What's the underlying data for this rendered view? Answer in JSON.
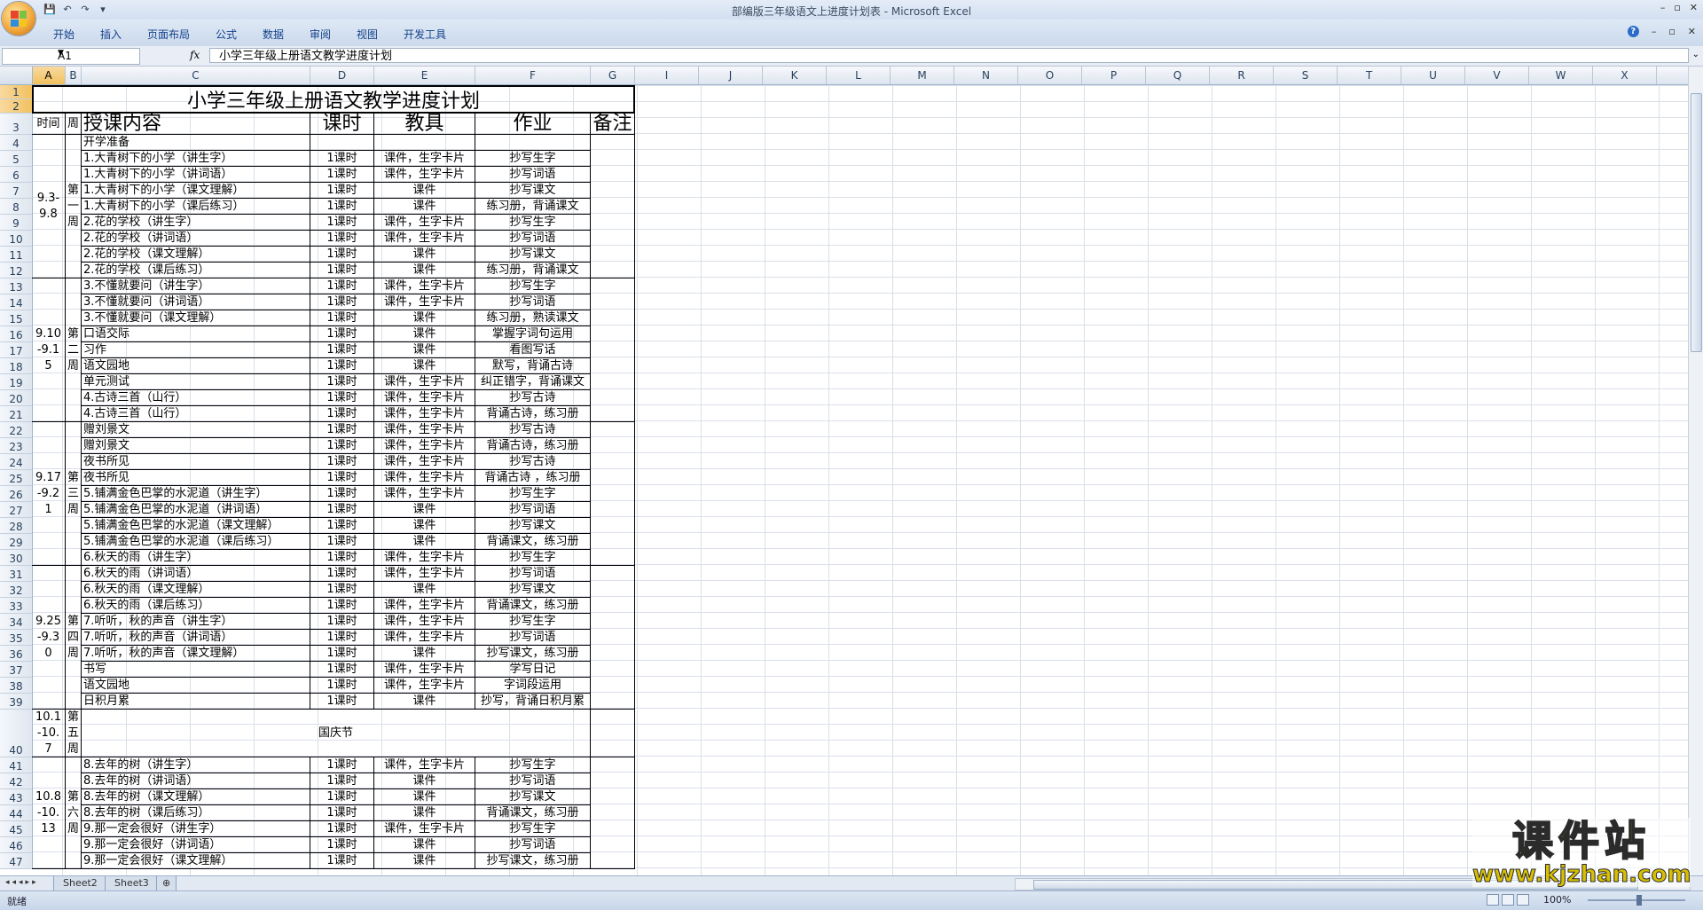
{
  "window": {
    "title": "部编版三年级语文上进度计划表 - Microsoft Excel",
    "controls": [
      "–",
      "▫",
      "✕"
    ]
  },
  "ribbon": {
    "tabs": [
      "开始",
      "插入",
      "页面布局",
      "公式",
      "数据",
      "审阅",
      "视图",
      "开发工具"
    ]
  },
  "formula_bar": {
    "name_box": "A1",
    "fx": "fx",
    "content": "小学三年级上册语文教学进度计划"
  },
  "columns": [
    "A",
    "B",
    "C",
    "D",
    "E",
    "F",
    "G",
    "I",
    "J",
    "K",
    "L",
    "M",
    "N",
    "O",
    "P",
    "Q",
    "R",
    "S",
    "T",
    "U",
    "V",
    "W",
    "X"
  ],
  "row_numbers": [
    "1",
    "2",
    "3",
    "4",
    "5",
    "6",
    "7",
    "8",
    "9",
    "10",
    "11",
    "12",
    "13",
    "14",
    "15",
    "16",
    "17",
    "18",
    "19",
    "20",
    "21",
    "22",
    "23",
    "24",
    "25",
    "26",
    "27",
    "28",
    "29",
    "30",
    "31",
    "32",
    "33",
    "34",
    "35",
    "36",
    "37",
    "38",
    "39",
    "40",
    "41",
    "42",
    "43",
    "44",
    "45",
    "46",
    "47"
  ],
  "sheet": {
    "title": "小学三年级上册语文教学进度计划",
    "headers": {
      "time": "时间",
      "week": "周",
      "content": "授课内容",
      "hours": "课时",
      "tools": "教具",
      "homework": "作业",
      "notes": "备注"
    },
    "groups": [
      {
        "time": "9.3-9.8",
        "week": "第一周"
      },
      {
        "time": "9.10-9.15",
        "week": "第二周"
      },
      {
        "time": "9.17-9.21",
        "week": "第三周"
      },
      {
        "time": "9.25-9.30",
        "week": "第四周"
      },
      {
        "time": "10.1-10.7",
        "week": "第五周",
        "merged": "国庆节"
      },
      {
        "time": "10.8-10.13",
        "week": "第六周"
      }
    ],
    "rows": [
      {
        "c": "开学准备",
        "d": "",
        "e": "",
        "f": ""
      },
      {
        "c": "1.大青树下的小学（讲生字）",
        "d": "1课时",
        "e": "课件，生字卡片",
        "f": "抄写生字"
      },
      {
        "c": "1.大青树下的小学（讲词语）",
        "d": "1课时",
        "e": "课件，生字卡片",
        "f": "抄写词语"
      },
      {
        "c": "1.大青树下的小学（课文理解）",
        "d": "1课时",
        "e": "课件",
        "f": "抄写课文"
      },
      {
        "c": "1.大青树下的小学（课后练习）",
        "d": "1课时",
        "e": "课件",
        "f": "练习册，背诵课文"
      },
      {
        "c": "2.花的学校（讲生字）",
        "d": "1课时",
        "e": "课件，生字卡片",
        "f": "抄写生字"
      },
      {
        "c": "2.花的学校（讲词语）",
        "d": "1课时",
        "e": "课件，生字卡片",
        "f": "抄写词语"
      },
      {
        "c": "2.花的学校（课文理解）",
        "d": "1课时",
        "e": "课件",
        "f": "抄写课文"
      },
      {
        "c": "2.花的学校（课后练习）",
        "d": "1课时",
        "e": "课件",
        "f": "练习册，背诵课文"
      },
      {
        "c": "3.不懂就要问（讲生字）",
        "d": "1课时",
        "e": "课件，生字卡片",
        "f": "抄写生字"
      },
      {
        "c": "3.不懂就要问（讲词语）",
        "d": "1课时",
        "e": "课件，生字卡片",
        "f": "抄写词语"
      },
      {
        "c": "3.不懂就要问（课文理解）",
        "d": "1课时",
        "e": "课件",
        "f": "练习册，熟读课文"
      },
      {
        "c": "口语交际",
        "d": "1课时",
        "e": "课件",
        "f": "掌握字词句运用"
      },
      {
        "c": "习作",
        "d": "1课时",
        "e": "课件",
        "f": "看图写话"
      },
      {
        "c": "语文园地",
        "d": "1课时",
        "e": "课件",
        "f": "默写，背诵古诗"
      },
      {
        "c": "单元测试",
        "d": "1课时",
        "e": "课件，生字卡片",
        "f": "纠正错字，背诵课文"
      },
      {
        "c": "4.古诗三首（山行）",
        "d": "1课时",
        "e": "课件，生字卡片",
        "f": "抄写古诗"
      },
      {
        "c": "4.古诗三首（山行）",
        "d": "1课时",
        "e": "课件，生字卡片",
        "f": "背诵古诗，练习册"
      },
      {
        "c": "赠刘景文",
        "d": "1课时",
        "e": "课件，生字卡片",
        "f": "抄写古诗"
      },
      {
        "c": "赠刘景文",
        "d": "1课时",
        "e": "课件，生字卡片",
        "f": "背诵古诗，练习册"
      },
      {
        "c": "夜书所见",
        "d": "1课时",
        "e": "课件，生字卡片",
        "f": "抄写古诗"
      },
      {
        "c": "夜书所见",
        "d": "1课时",
        "e": "课件，生字卡片",
        "f": "背诵古诗 ，练习册"
      },
      {
        "c": "5.铺满金色巴掌的水泥道（讲生字）",
        "d": "1课时",
        "e": "课件，生字卡片",
        "f": "抄写生字"
      },
      {
        "c": "5.铺满金色巴掌的水泥道（讲词语）",
        "d": "1课时",
        "e": "课件",
        "f": "抄写词语"
      },
      {
        "c": "5.铺满金色巴掌的水泥道（课文理解）",
        "d": "1课时",
        "e": "课件",
        "f": "抄写课文"
      },
      {
        "c": "5.铺满金色巴掌的水泥道（课后练习）",
        "d": "1课时",
        "e": "课件",
        "f": "背诵课文，练习册"
      },
      {
        "c": "6.秋天的雨（讲生字）",
        "d": "1课时",
        "e": "课件，生字卡片",
        "f": "抄写生字"
      },
      {
        "c": "6.秋天的雨（讲词语）",
        "d": "1课时",
        "e": "课件，生字卡片",
        "f": "抄写词语"
      },
      {
        "c": "6.秋天的雨（课文理解）",
        "d": "1课时",
        "e": "课件",
        "f": "抄写课文"
      },
      {
        "c": "6.秋天的雨（课后练习）",
        "d": "1课时",
        "e": "课件，生字卡片",
        "f": "背诵课文，练习册"
      },
      {
        "c": "7.听听，秋的声音（讲生字）",
        "d": "1课时",
        "e": "课件，生字卡片",
        "f": "抄写生字"
      },
      {
        "c": "7.听听，秋的声音（讲词语）",
        "d": "1课时",
        "e": "课件，生字卡片",
        "f": "抄写词语"
      },
      {
        "c": "7.听听，秋的声音（课文理解）",
        "d": "1课时",
        "e": "课件",
        "f": "抄写课文，练习册"
      },
      {
        "c": "书写",
        "d": "1课时",
        "e": "课件，生字卡片",
        "f": "学写日记"
      },
      {
        "c": "语文园地",
        "d": "1课时",
        "e": "课件，生字卡片",
        "f": "字词段运用"
      },
      {
        "c": "日积月累",
        "d": "1课时",
        "e": "课件",
        "f": "抄写，背诵日积月累"
      },
      {
        "c": "8.去年的树（讲生字）",
        "d": "1课时",
        "e": "课件，生字卡片",
        "f": "抄写生字"
      },
      {
        "c": "8.去年的树（讲词语）",
        "d": "1课时",
        "e": "课件",
        "f": "抄写词语"
      },
      {
        "c": "8.去年的树（课文理解）",
        "d": "1课时",
        "e": "课件",
        "f": "抄写课文"
      },
      {
        "c": "8.去年的树（课后练习）",
        "d": "1课时",
        "e": "课件",
        "f": "背诵课文，练习册"
      },
      {
        "c": "9.那一定会很好（讲生字）",
        "d": "1课时",
        "e": "课件，生字卡片",
        "f": "抄写生字"
      },
      {
        "c": "9.那一定会很好（讲词语）",
        "d": "1课时",
        "e": "课件",
        "f": "抄写词语"
      },
      {
        "c": "9.那一定会很好（课文理解）",
        "d": "1课时",
        "e": "课件",
        "f": "抄写课文，练习册"
      }
    ]
  },
  "sheet_tabs": [
    "Sheet2",
    "Sheet3"
  ],
  "status": {
    "ready": "就绪",
    "zoom": "100%"
  },
  "watermark": {
    "text": "课件站",
    "url": "www.kjzhan.com"
  }
}
